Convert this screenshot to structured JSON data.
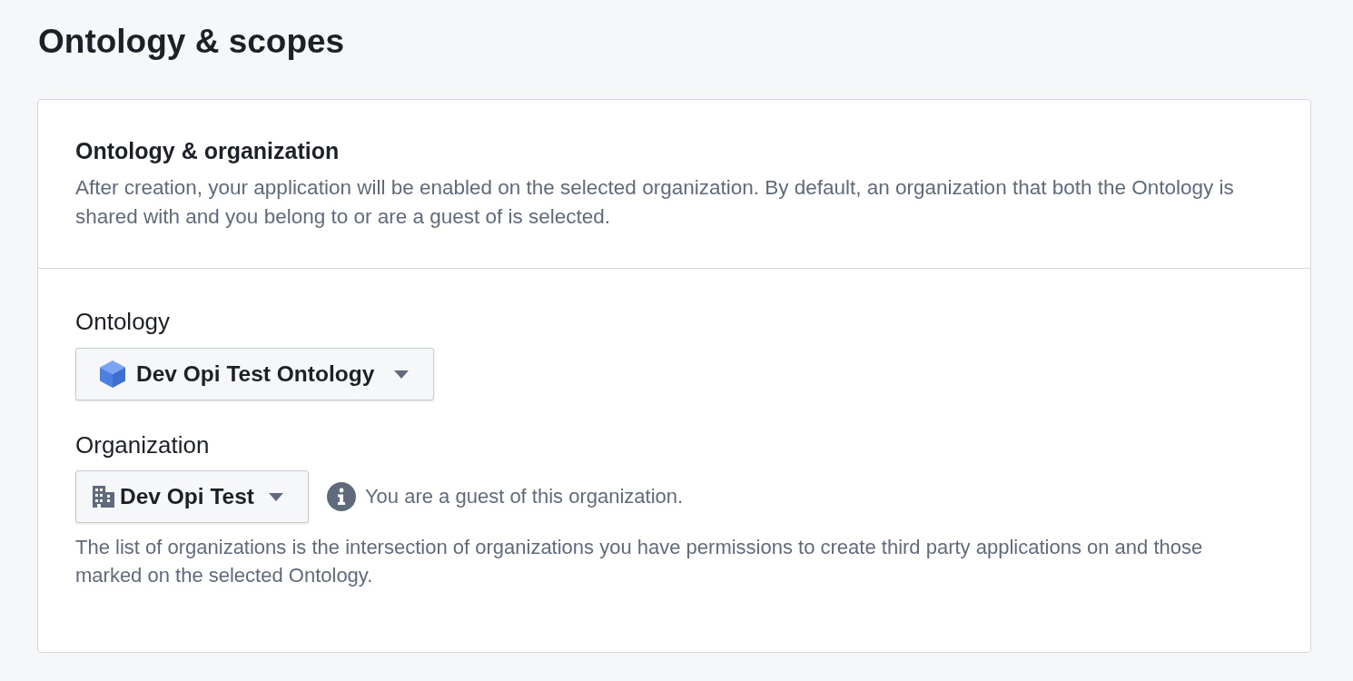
{
  "heading": "Ontology & scopes",
  "card": {
    "title": "Ontology & organization",
    "description": "After creation, your application will be enabled on the selected organization. By default, an organization that both the Ontology is shared with and you belong to or are a guest of is selected."
  },
  "ontology": {
    "label": "Ontology",
    "value": "Dev Opi Test Ontology"
  },
  "organization": {
    "label": "Organization",
    "value": "Dev Opi Test",
    "note": "You are a guest of this organization.",
    "helper": "The list of organizations is the intersection of organizations you have permissions to create third party applications on and those marked on the selected Ontology."
  }
}
